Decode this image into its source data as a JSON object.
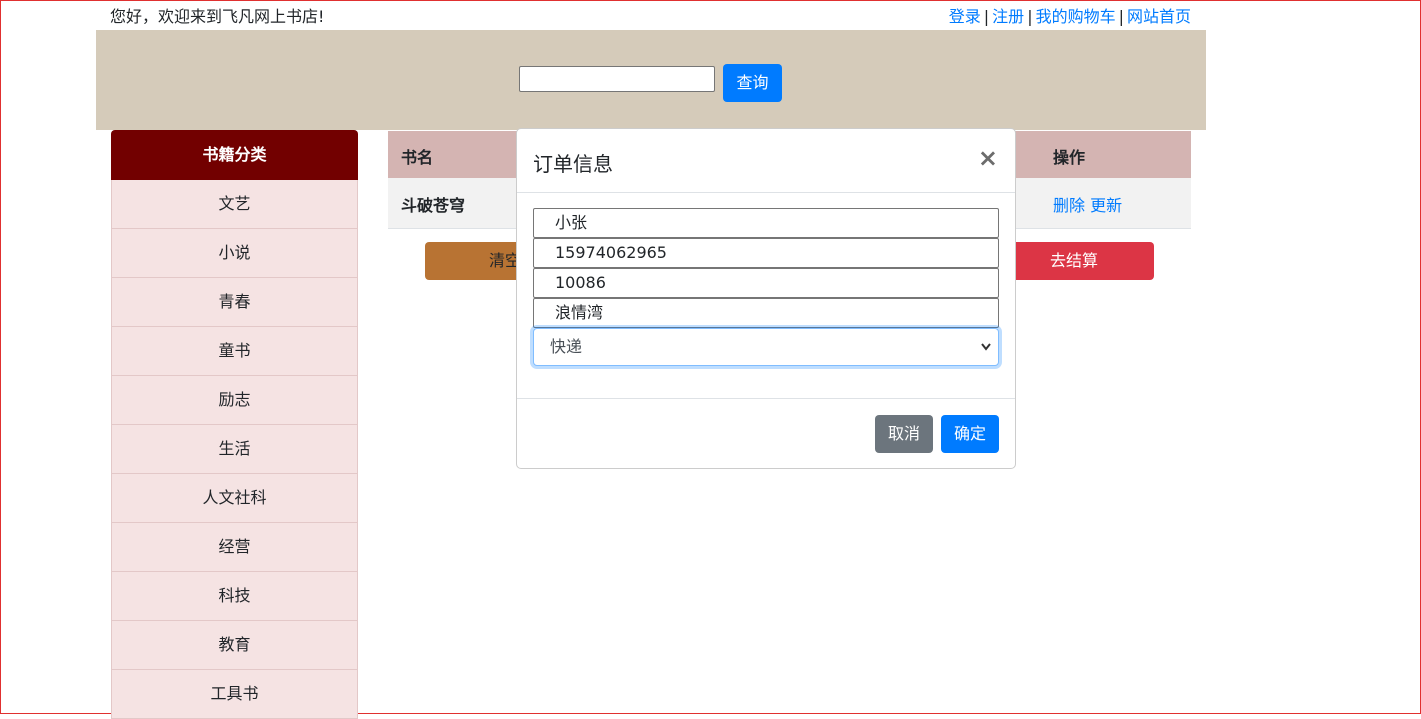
{
  "header": {
    "welcome": "您好，欢迎来到飞凡网上书店!",
    "links": [
      "登录",
      "注册",
      "我的购物车",
      "网站首页"
    ],
    "separator": "|"
  },
  "search": {
    "value": "",
    "button_label": "查询"
  },
  "sidebar": {
    "title": "书籍分类",
    "items": [
      "文艺",
      "小说",
      "青春",
      "童书",
      "励志",
      "生活",
      "人文社科",
      "经营",
      "科技",
      "教育",
      "工具书"
    ]
  },
  "cart": {
    "columns": {
      "name": "书名",
      "operations": "操作"
    },
    "rows": [
      {
        "book": "斗破苍穹",
        "delete": "删除",
        "update": "更新"
      }
    ],
    "clear_label": "清空",
    "checkout_label": "去结算"
  },
  "modal": {
    "title": "订单信息",
    "close": "×",
    "fields": {
      "name": "小张",
      "phone": "15974062965",
      "postcode": "10086",
      "address": "浪情湾"
    },
    "delivery": {
      "selected": "快递"
    },
    "cancel_label": "取消",
    "confirm_label": "确定"
  },
  "colors": {
    "accent": "#007bff",
    "sidebar_header": "#720000",
    "sidebar_item": "#f5e3e3",
    "search_band": "#d5cbba",
    "table_header": "#d4b4b2",
    "danger": "#dc3545",
    "clear_button": "#b87333",
    "secondary": "#6c757d"
  }
}
